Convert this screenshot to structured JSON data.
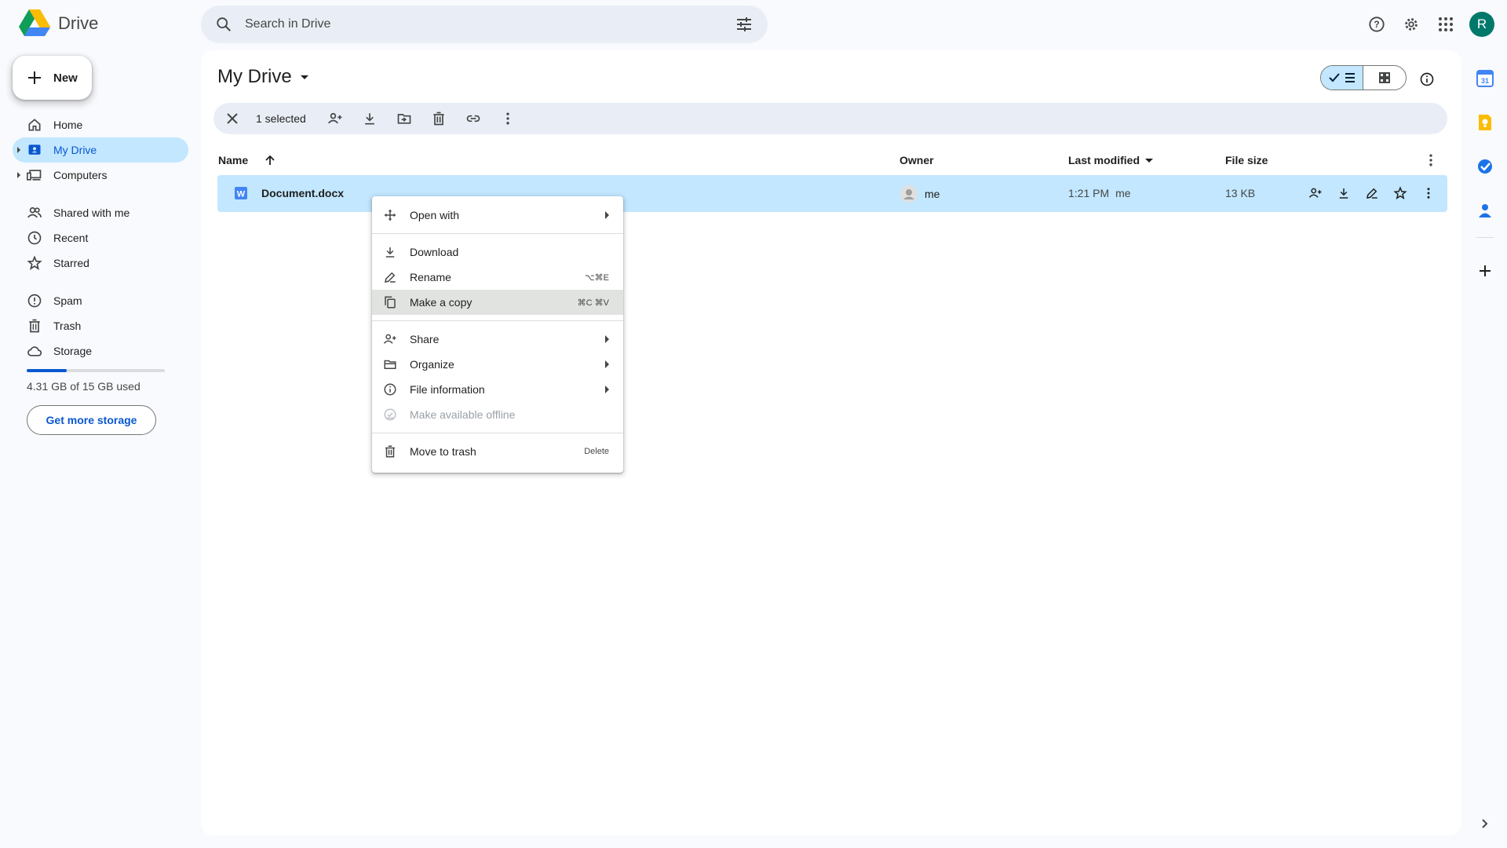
{
  "app": {
    "name": "Drive"
  },
  "search": {
    "placeholder": "Search in Drive"
  },
  "user": {
    "initial": "R",
    "color": "#00796b"
  },
  "new_button": {
    "label": "New"
  },
  "sidebar": {
    "items": [
      {
        "label": "Home",
        "icon": "home-icon"
      },
      {
        "label": "My Drive",
        "icon": "my-drive-icon",
        "active": true
      },
      {
        "label": "Computers",
        "icon": "computers-icon"
      },
      {
        "label": "Shared with me",
        "icon": "shared-icon"
      },
      {
        "label": "Recent",
        "icon": "clock-icon"
      },
      {
        "label": "Starred",
        "icon": "star-icon"
      },
      {
        "label": "Spam",
        "icon": "spam-icon"
      },
      {
        "label": "Trash",
        "icon": "trash-icon"
      },
      {
        "label": "Storage",
        "icon": "cloud-icon"
      }
    ]
  },
  "storage": {
    "used_text": "4.31 GB of 15 GB used",
    "used_fraction": 0.287,
    "button_label": "Get more storage"
  },
  "main": {
    "title": "My Drive"
  },
  "selection": {
    "count_label": "1 selected"
  },
  "table": {
    "columns": {
      "name": "Name",
      "owner": "Owner",
      "modified": "Last modified",
      "size": "File size"
    },
    "rows": [
      {
        "name": "Document.docx",
        "owner": "me",
        "modified": "1:21 PM",
        "modified_by": "me",
        "size": "13 KB",
        "selected": true
      }
    ]
  },
  "context_menu": {
    "items": [
      {
        "label": "Open with",
        "icon": "open-with-icon",
        "submenu": true
      },
      {
        "label": "Download",
        "icon": "download-icon"
      },
      {
        "label": "Rename",
        "icon": "rename-icon",
        "shortcut": "⌥⌘E"
      },
      {
        "label": "Make a copy",
        "icon": "copy-icon",
        "shortcut": "⌘C ⌘V",
        "highlighted": true
      },
      {
        "label": "Share",
        "icon": "share-icon",
        "submenu": true
      },
      {
        "label": "Organize",
        "icon": "organize-icon",
        "submenu": true
      },
      {
        "label": "File information",
        "icon": "info-icon",
        "submenu": true
      },
      {
        "label": "Make available offline",
        "icon": "offline-icon",
        "disabled": true
      },
      {
        "label": "Move to trash",
        "icon": "trash-icon",
        "shortcut": "Delete"
      }
    ]
  },
  "colors": {
    "accent": "#0b57d0",
    "selection": "#c2e7ff",
    "word_blue": "#4285f4"
  }
}
